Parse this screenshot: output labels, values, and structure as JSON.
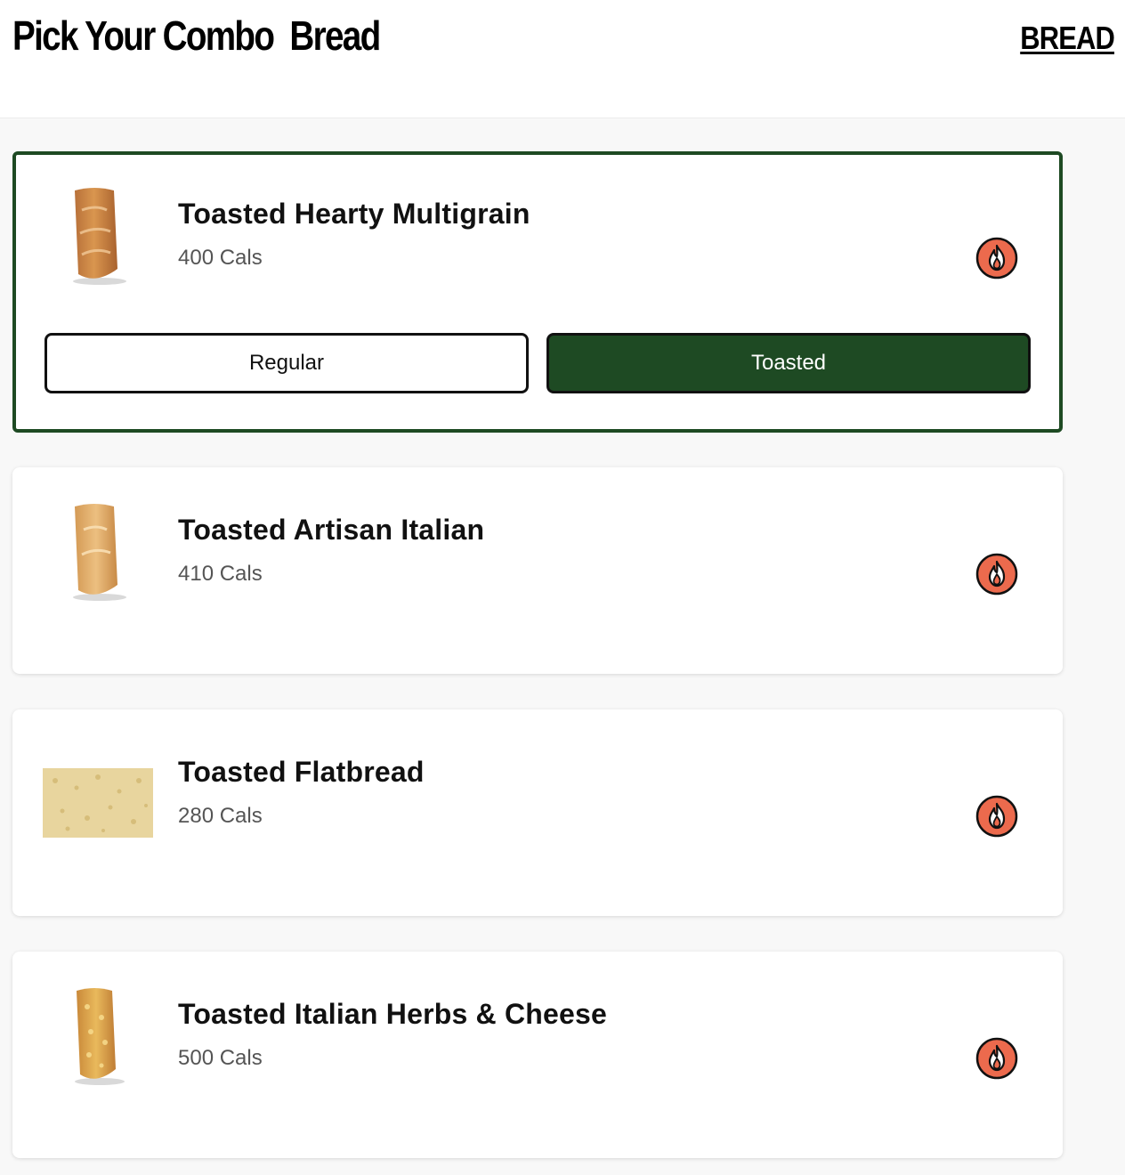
{
  "header": {
    "title": "Pick Your Combo  Bread",
    "link": "BREAD"
  },
  "colors": {
    "selected_border": "#1e4a23",
    "toasted_button": "#1e4a23",
    "fire_icon": "#ec6a4d"
  },
  "breads": [
    {
      "name": "Toasted Hearty Multigrain",
      "cals": "400 Cals",
      "image": "multigrain-loaf",
      "icon": "fire-icon",
      "selected": true,
      "options": {
        "regular_label": "Regular",
        "toasted_label": "Toasted",
        "active": "Toasted"
      }
    },
    {
      "name": "Toasted Artisan Italian",
      "cals": "410 Cals",
      "image": "italian-loaf",
      "icon": "fire-icon",
      "selected": false
    },
    {
      "name": "Toasted Flatbread",
      "cals": "280 Cals",
      "image": "flatbread",
      "icon": "fire-icon",
      "selected": false
    },
    {
      "name": "Toasted Italian Herbs & Cheese",
      "cals": "500 Cals",
      "image": "herbs-cheese-loaf",
      "icon": "fire-icon",
      "selected": false
    }
  ]
}
